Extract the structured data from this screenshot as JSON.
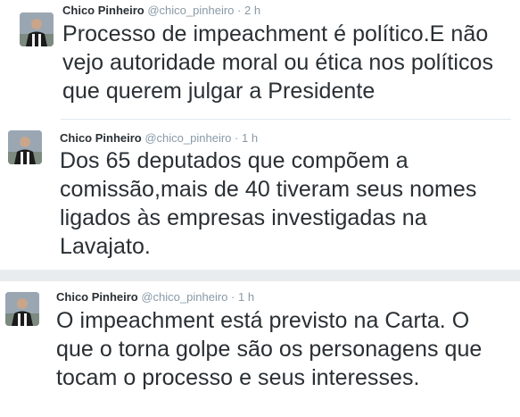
{
  "colors": {
    "text": "#292f33",
    "meta": "#8899a6",
    "separator_band": "#e9ecee"
  },
  "tweets": [
    {
      "avatar_icon": "user-avatar-icon",
      "name": "Chico Pinheiro",
      "handle": "@chico_pinheiro",
      "dot": "·",
      "time": "2 h",
      "lines": [
        "Processo de impeachment é político.E não",
        "vejo autoridade moral ou ética nos políticos",
        "que querem julgar a Presidente"
      ]
    },
    {
      "avatar_icon": "user-avatar-icon",
      "name": "Chico Pinheiro",
      "handle": "@chico_pinheiro",
      "dot": "·",
      "time": "1 h",
      "lines": [
        "Dos 65 deputados que compõem a",
        "comissão,mais de 40 tiveram seus nomes",
        "ligados às empresas investigadas na",
        "Lavajato."
      ]
    },
    {
      "avatar_icon": "user-avatar-icon",
      "name": "Chico Pinheiro",
      "handle": "@chico_pinheiro",
      "dot": "·",
      "time": "1 h",
      "lines": [
        "O impeachment está previsto na Carta. O",
        "que o torna golpe são os personagens que",
        "tocam o processo e seus interesses."
      ]
    }
  ]
}
